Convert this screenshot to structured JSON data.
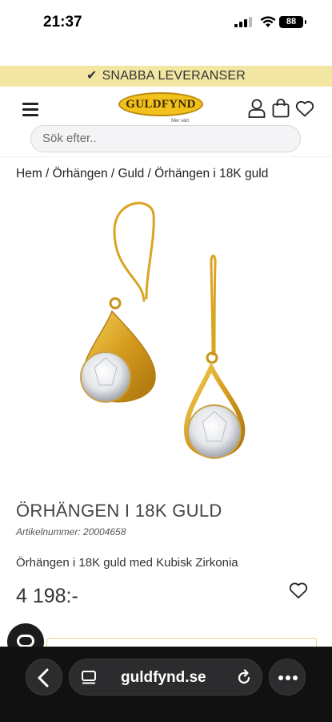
{
  "status_bar": {
    "time": "21:37",
    "battery": "88"
  },
  "promo_band": {
    "text": "SNABBA LEVERANSER"
  },
  "header": {
    "logo_text": "GULDFYND",
    "tagline": "Mer värt",
    "search_placeholder": "Sök efter.."
  },
  "breadcrumb": {
    "text": "Hem / Örhängen / Guld / Örhängen i 18K guld"
  },
  "product": {
    "title": "ÖRHÄNGEN I 18K GULD",
    "article_number": "Artikelnummer: 20004658",
    "description": "Örhängen i 18K guld med Kubisk Zirkonia",
    "price": "4 198:-"
  },
  "browser": {
    "url": "guldfynd.se"
  },
  "colors": {
    "promo_band": "#f3e6a3",
    "logo_gold": "#f2c11c",
    "browser_bar": "#111111"
  }
}
